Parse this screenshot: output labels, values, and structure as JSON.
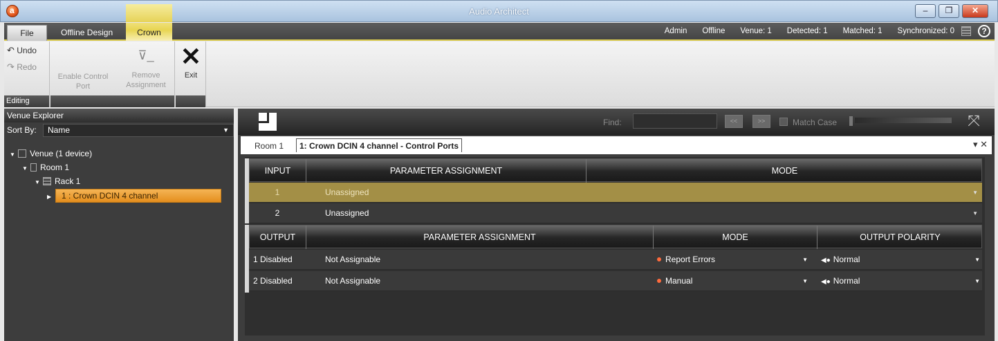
{
  "window": {
    "title": "Audio Architect",
    "minimize": "–",
    "maximize": "❐",
    "close": "✕"
  },
  "tabs": {
    "file": "File",
    "offline": "Offline Design",
    "crown": "Crown"
  },
  "status": {
    "user": "Admin",
    "mode": "Offline",
    "venue": "Venue: 1",
    "detected": "Detected: 1",
    "matched": "Matched: 1",
    "synchronized": "Synchronized: 0",
    "help": "?"
  },
  "ribbon": {
    "editing": {
      "undo": "Undo",
      "redo": "Redo",
      "group_label": "Editing"
    },
    "enable_control_port": [
      "Enable Control",
      "Port"
    ],
    "remove_assignment": [
      "Remove",
      "Assignment"
    ],
    "exit": "Exit"
  },
  "venue_explorer": {
    "title": "Venue Explorer",
    "sort_by_label": "Sort By:",
    "sort_by_value": "Name",
    "tree": {
      "venue": "Venue (1 device)",
      "room": "Room 1",
      "rack": "Rack 1",
      "device": "1 : Crown DCIN 4 channel"
    }
  },
  "toolbar": {
    "find_label": "Find:",
    "find_value": "",
    "prev": "<<",
    "next": ">>",
    "match_case": "Match Case"
  },
  "doc_tabs": {
    "room": "Room 1",
    "active": "1: Crown DCIN 4 channel - Control Ports",
    "menu": "▾ ✕"
  },
  "input_table": {
    "headers": [
      "INPUT",
      "PARAMETER ASSIGNMENT",
      "MODE"
    ],
    "rows": [
      {
        "input": "1",
        "assignment": "Unassigned",
        "mode": ""
      },
      {
        "input": "2",
        "assignment": "Unassigned",
        "mode": ""
      }
    ]
  },
  "output_table": {
    "headers": [
      "OUTPUT",
      "PARAMETER ASSIGNMENT",
      "MODE",
      "OUTPUT POLARITY"
    ],
    "rows": [
      {
        "output": "1  Disabled",
        "assignment": "Not Assignable",
        "mode": "Report Errors",
        "polarity": "Normal"
      },
      {
        "output": "2  Disabled",
        "assignment": "Not Assignable",
        "mode": "Manual",
        "polarity": "Normal"
      }
    ]
  },
  "colors": {
    "accent_yellow": "#e8d552",
    "selected_row": "#a38f46",
    "device_highlight": "#f0a840",
    "error_dot": "#ff6b3d"
  }
}
